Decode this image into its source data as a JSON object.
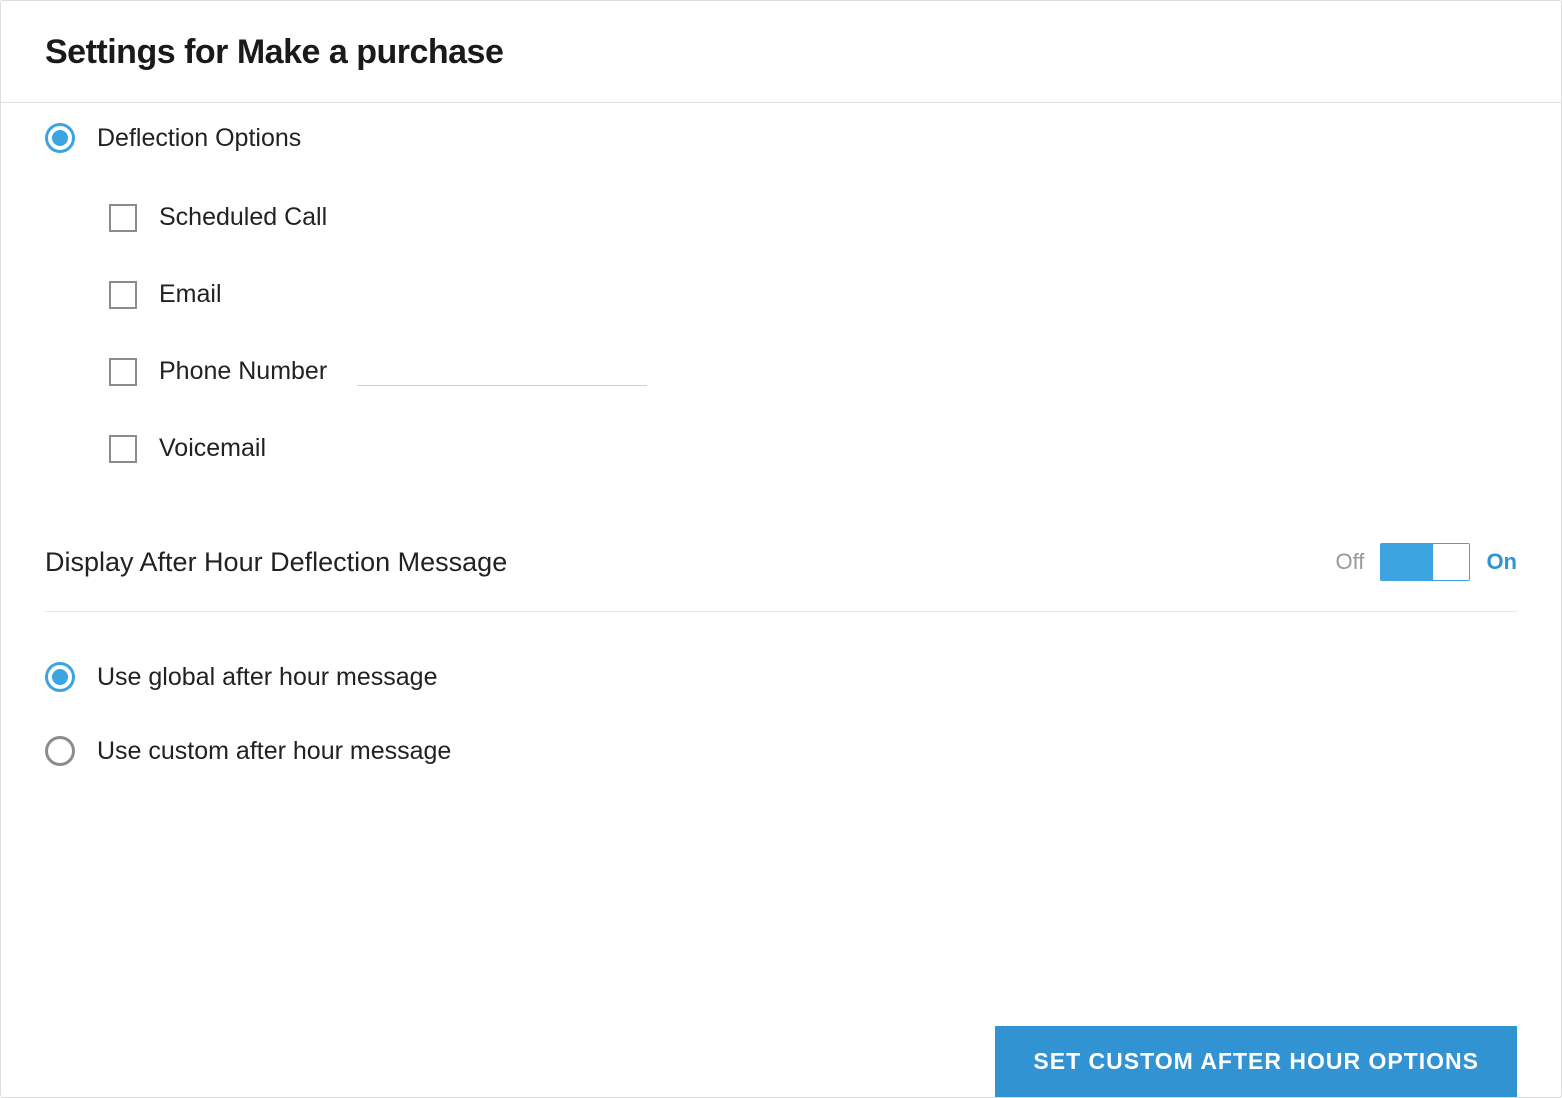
{
  "header": {
    "title": "Settings for Make a purchase"
  },
  "deflection": {
    "heading": "Deflection Options",
    "options": {
      "scheduled_call": "Scheduled Call",
      "email": "Email",
      "phone_number": "Phone Number",
      "voicemail": "Voicemail"
    },
    "phone_value": ""
  },
  "after_hours": {
    "display_label": "Display After Hour Deflection Message",
    "off_label": "Off",
    "on_label": "On",
    "use_global": "Use global after hour message",
    "use_custom": "Use custom after hour message"
  },
  "actions": {
    "set_custom": "SET CUSTOM AFTER HOUR OPTIONS"
  }
}
